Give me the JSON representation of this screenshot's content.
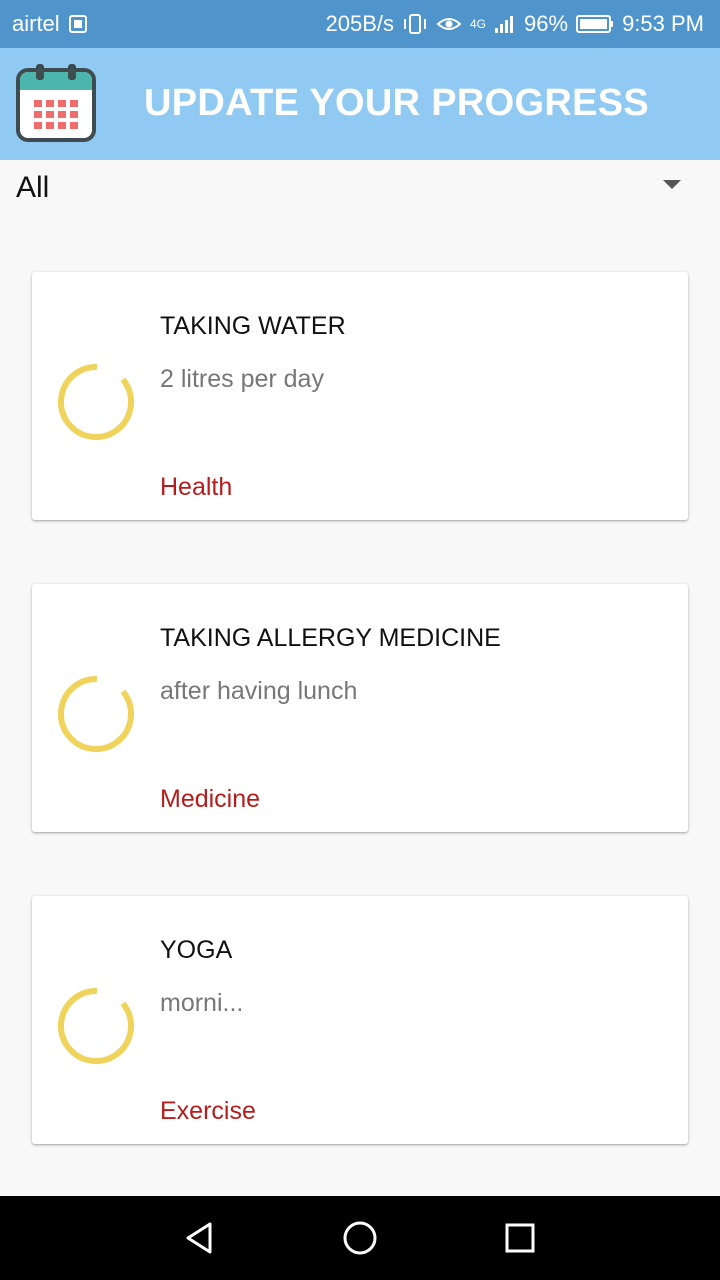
{
  "status_bar": {
    "carrier": "airtel",
    "speed": "205B/s",
    "network": "4G",
    "battery": "96%",
    "time": "9:53 PM"
  },
  "app_bar": {
    "title": "UPDATE YOUR PROGRESS",
    "logo_icon": "calendar-icon"
  },
  "filter": {
    "selected": "All"
  },
  "cards": [
    {
      "title": "TAKING WATER",
      "description": "2 litres per day",
      "category": "Health"
    },
    {
      "title": "TAKING ALLERGY MEDICINE",
      "description": "after having lunch",
      "category": "Medicine"
    },
    {
      "title": "YOGA",
      "description": "morni...",
      "category": "Exercise"
    }
  ],
  "colors": {
    "status_bar": "#4f95cc",
    "app_bar": "#90caf3",
    "spinner": "#f0d35a",
    "category": "#b71c1c"
  }
}
